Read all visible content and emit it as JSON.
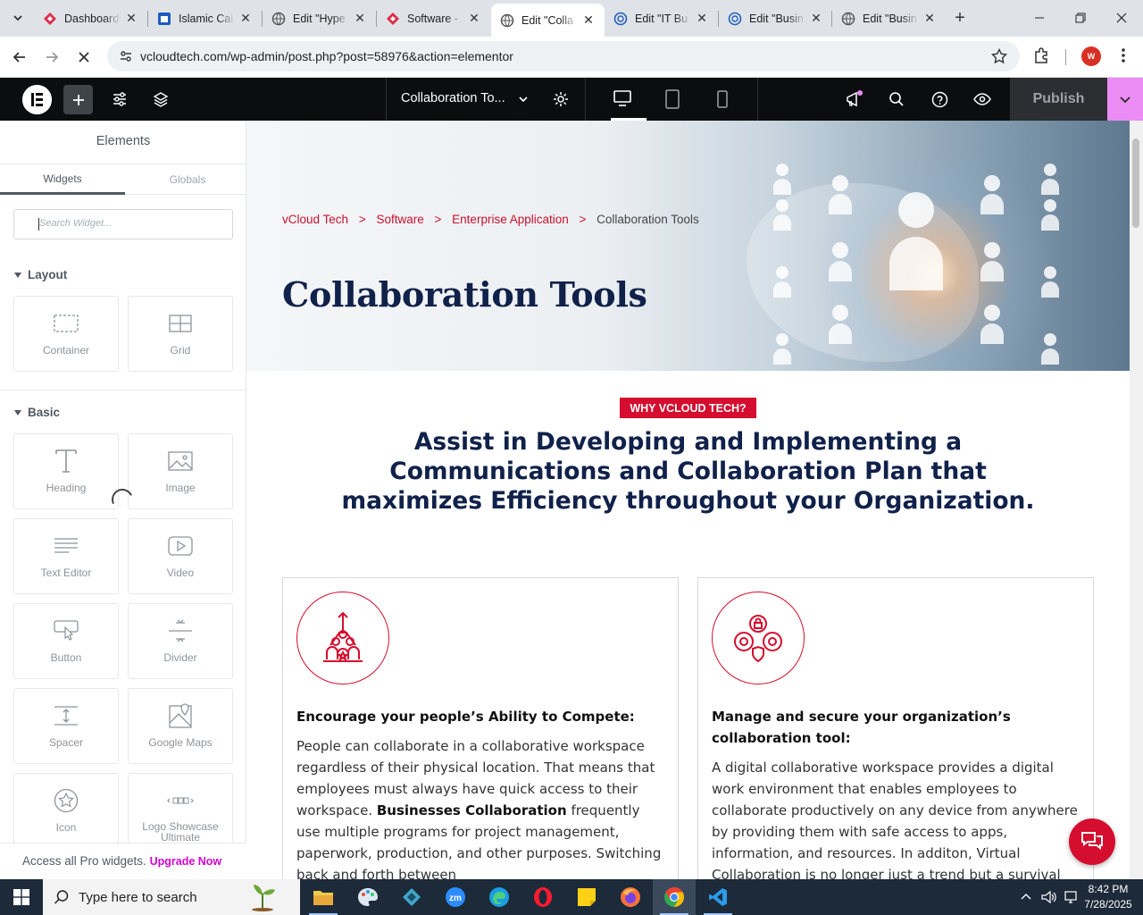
{
  "browser": {
    "tabs": [
      {
        "title": "Dashboard",
        "favicon": "red-diamond"
      },
      {
        "title": "Islamic Cal",
        "favicon": "blue-square"
      },
      {
        "title": "Edit \"Hype",
        "favicon": "globe"
      },
      {
        "title": "Software -",
        "favicon": "red-diamond"
      },
      {
        "title": "Edit \"Colla",
        "favicon": "elementor"
      },
      {
        "title": "Edit \"IT Bu",
        "favicon": "wp-blue"
      },
      {
        "title": "Edit \"Busin",
        "favicon": "wp-blue"
      },
      {
        "title": "Edit \"Busin",
        "favicon": "globe"
      }
    ],
    "active_tab_index": 4,
    "url": "vcloudtech.com/wp-admin/post.php?post=58976&action=elementor",
    "profile_initial": "W"
  },
  "editor": {
    "document_name": "Collaboration To...",
    "publish_label": "Publish"
  },
  "panel": {
    "title": "Elements",
    "tabs": [
      "Widgets",
      "Globals"
    ],
    "search_placeholder": "Search Widget...",
    "categories": {
      "layout": "Layout",
      "basic": "Basic"
    },
    "layout_widgets": [
      {
        "label": "Container",
        "icon": "container-icon"
      },
      {
        "label": "Grid",
        "icon": "grid-icon"
      }
    ],
    "basic_widgets": [
      {
        "label": "Heading",
        "icon": "heading-icon"
      },
      {
        "label": "Image",
        "icon": "image-icon"
      },
      {
        "label": "Text Editor",
        "icon": "text-editor-icon"
      },
      {
        "label": "Video",
        "icon": "video-icon"
      },
      {
        "label": "Button",
        "icon": "button-icon"
      },
      {
        "label": "Divider",
        "icon": "divider-icon"
      },
      {
        "label": "Spacer",
        "icon": "spacer-icon"
      },
      {
        "label": "Google Maps",
        "icon": "map-icon"
      },
      {
        "label": "Icon",
        "icon": "star-icon"
      },
      {
        "label": "Logo Showcase Ultimate",
        "icon": "logo-showcase-icon"
      }
    ],
    "footer_text": "Access all Pro widgets.",
    "footer_link": "Upgrade Now"
  },
  "page": {
    "breadcrumbs": [
      "vCloud Tech",
      "Software",
      "Enterprise Application",
      "Collaboration Tools"
    ],
    "breadcrumb_sep": ">",
    "title": "Collaboration Tools",
    "badge": "WHY VCLOUD TECH?",
    "headline": "Assist in Developing and Implementing a Communications and Collaboration Plan that maximizes Efficiency throughout your Organization.",
    "cards": [
      {
        "heading": "Encourage your people’s Ability to Compete:",
        "p1": "People can collaborate in a collaborative workspace regardless of their physical location. That means that employees must always have quick access to their workspace.",
        "p1_bold": "Businesses Collaboration",
        "p1_tail": "frequently use multiple programs for project management, paperwork, production, and other purposes. Switching back and forth between"
      },
      {
        "heading": "Manage and secure your organization’s collaboration tool:",
        "p1": "A digital collaborative workspace provides a digital work environment that enables employees to collaborate productively on any device from anywhere by providing them with safe access to apps, information, and resources. In additon, Virtual Collaboration is no longer just a trend but a survival"
      }
    ]
  },
  "taskbar": {
    "search_placeholder": "Type here to search",
    "time": "8:42 PM",
    "date": "7/28/2025"
  },
  "colors": {
    "accent_red": "#d50d2e",
    "navy": "#10214a",
    "publish_dropdown": "#eb8df5",
    "upgrade_link": "#d004d4"
  }
}
